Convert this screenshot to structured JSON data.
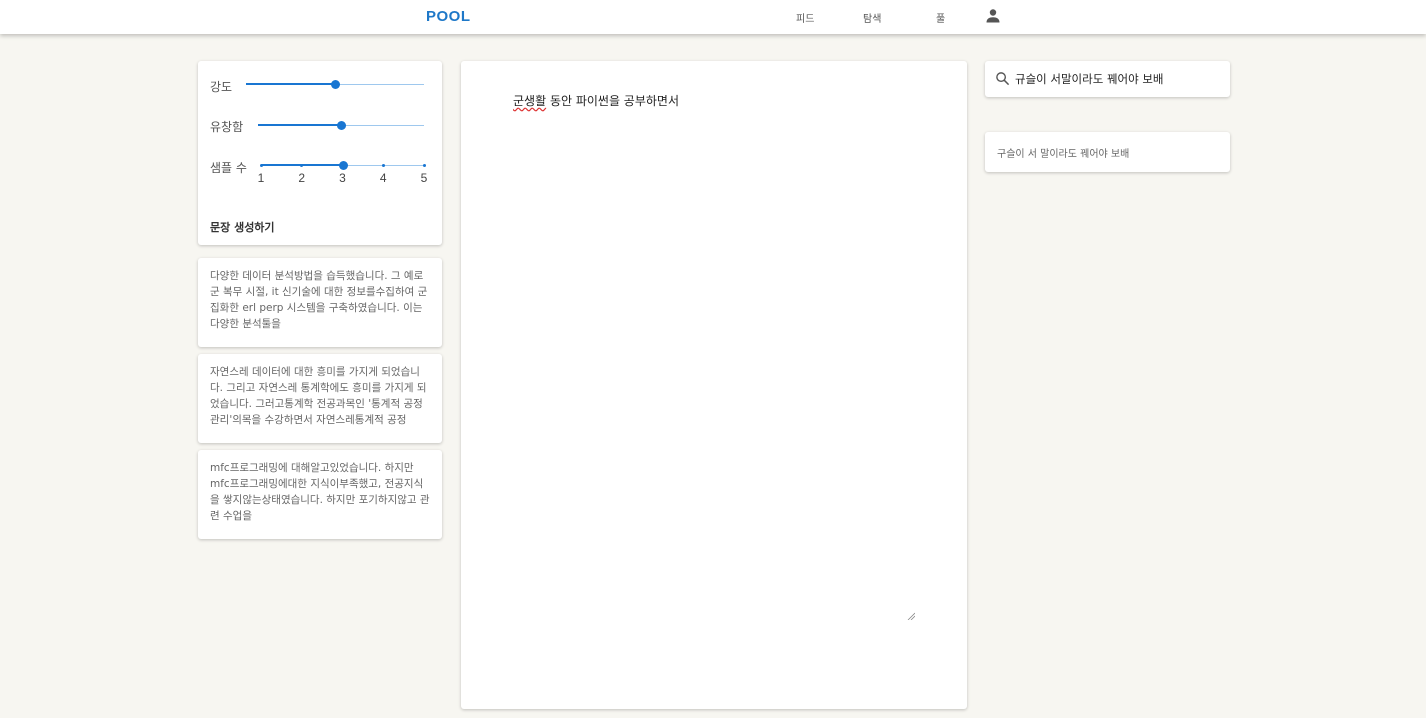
{
  "header": {
    "logo": "POOL",
    "nav": {
      "feed": "피드",
      "explore": "탐색",
      "pool": "풀"
    },
    "user_icon": "person-icon",
    "accent_color": "#1976d2"
  },
  "controls": {
    "intensity": {
      "label": "강도",
      "value": 0.5
    },
    "fluency": {
      "label": "유창함",
      "value": 0.5
    },
    "samples": {
      "label": "샘플 수",
      "ticks": [
        "1",
        "2",
        "3",
        "4",
        "5"
      ],
      "value": 3
    },
    "generate_label": "문장 생성하기"
  },
  "results": [
    {
      "text": "다양한 데이터 분석방법을 습득했습니다. 그 예로 군 복무 시절, it 신기술에 대한 정보를수집하여 군집화한 erl perp 시스템을 구축하였습니다. 이는 다양한 분석툴을"
    },
    {
      "text": "자연스레 데이터에 대한 흥미를 가지게 되었습니다. 그리고 자연스레 통계학에도 흥미를 가지게 되었습니다. 그러고통계학 전공과목인 '통계적 공정관리'의목을 수강하면서 자연스레통계적 공정"
    },
    {
      "text": "mfc프로그래밍에 대해알고있었습니다. 하지만 mfc프로그래밍에대한 지식이부족했고, 전공지식을 쌓지않는상태였습니다. 하지만 포기하지않고 관련 수업을"
    }
  ],
  "editor": {
    "misspelled": "군생활",
    "rest": " 동안 파이썬을 공부하면서"
  },
  "search": {
    "icon": "search-icon",
    "value": "규슬이 서말이라도 꿰어야 보배"
  },
  "suggestion": {
    "text": "구슬이 서 말이라도 꿰어야 보배"
  }
}
